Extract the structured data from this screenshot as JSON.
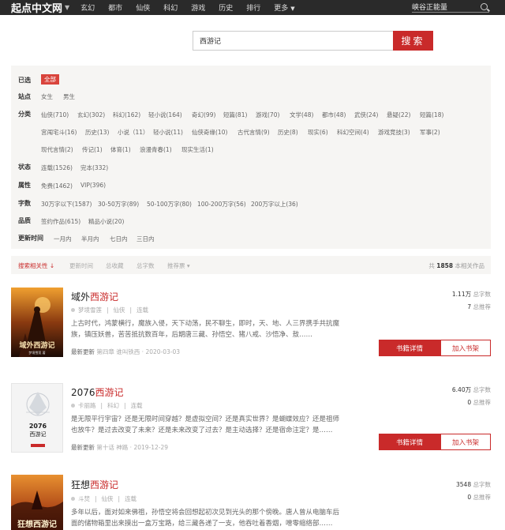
{
  "topnav": {
    "logo": "起点中文网",
    "links": [
      "玄幻",
      "都市",
      "仙侠",
      "科幻",
      "游戏",
      "历史",
      "排行",
      "更多"
    ],
    "search_text": "峡谷正能量"
  },
  "search": {
    "value": "西游记",
    "button_label": "搜索"
  },
  "filters": {
    "selected_label": "已选",
    "selected_value": "全部",
    "site_label": "站点",
    "site_options": [
      "女生",
      "男生"
    ],
    "category_label": "分类",
    "category_row1": [
      "仙侠(710)",
      "玄幻(302)",
      "科幻(162)",
      "轻小说(164)",
      "奇幻(99)",
      "短篇(81)",
      "游戏(70)",
      "文学(48)",
      "都市(48)",
      "武侠(24)",
      "悬疑(22)",
      "短篇(18)"
    ],
    "category_row2": [
      "宫闱宅斗(16)",
      "历史(13)",
      "小说（11）",
      "轻小说(11)",
      "仙侠奇缘(10)",
      "古代言情(9)",
      "历史(8)",
      "现实(6)",
      "科幻空间(4)",
      "游戏竞技(3)",
      "军事(2)"
    ],
    "category_row3": [
      "现代言情(2)",
      "传记(1)",
      "体育(1)",
      "浪漫青春(1)",
      "现实生活(1)"
    ],
    "status_label": "状态",
    "status_options": [
      "连载(1526)",
      "完本(332)"
    ],
    "attr_label": "属性",
    "attr_options": [
      "免费(1462)",
      "VIP(396)"
    ],
    "words_label": "字数",
    "words_options": [
      "30万字以下(1587)",
      "30-50万字(89)",
      "50-100万字(80)",
      "100-200万字(56)",
      "200万字以上(36)"
    ],
    "quality_label": "品质",
    "quality_options": [
      "签约作品(615)",
      "精品小说(20)"
    ],
    "update_label": "更新时间",
    "update_options": [
      "一月内",
      "半月内",
      "七日内",
      "三日内"
    ]
  },
  "sortbar": {
    "items": [
      "搜索相关性 ↓",
      "更新时间",
      "总收藏",
      "总字数",
      "推荐票 ▾"
    ],
    "count_prefix": "共",
    "count": "1858",
    "count_suffix": "本相关作品"
  },
  "books": [
    {
      "title_plain": "域外",
      "title_hl": "西游记",
      "author": "梦境雪莲",
      "genre": "仙侠",
      "status": "连载",
      "intro": "上古时代，鸿蒙横行，魔族入侵，天下动荡，民不聊生，即时，天、地、人三界携手共抗魔族，镇压妖兽，苦苦抵抗数百年，后期唐三藏、孙悟空、猪八戒、沙悟净、敖……",
      "update_label": "最新更新",
      "update_chapter": "第四章 谁叫铁西",
      "update_time": "2020-03-03",
      "words_num": "1.11万",
      "words_unit": "总字数",
      "rec_num": "7",
      "rec_unit": "总推荐",
      "detail_label": "书籍详情",
      "shelf_label": "加入书架",
      "cover_text": "域外西游记",
      "cover_author": "梦境雪莲 著"
    },
    {
      "title_plain": "2076",
      "title_hl": "西游记",
      "author": "卡丽路",
      "genre": "科幻",
      "status": "连载",
      "intro": "是无限平行宇宙？还是无限时间穿越？是虚拟空间？还是真实世界？是蝴蝶效应？还是祖师也放牛？是过去改变了未来？还是未来改变了过去？是主动选择？还是宿命注定？是……",
      "update_label": "最新更新",
      "update_chapter": "第十话 神路",
      "update_time": "2019-12-29",
      "words_num": "6.40万",
      "words_unit": "总字数",
      "rec_num": "0",
      "rec_unit": "总推荐",
      "detail_label": "书籍详情",
      "shelf_label": "加入书架",
      "cover_text": "2076\n西游记",
      "cover_author": ""
    },
    {
      "title_plain": "狂想",
      "title_hl": "西游记",
      "author": "斗焚",
      "genre": "仙侠",
      "status": "连载",
      "intro": "多年以后，面对如来佛祖，孙悟空将会回想起初次见到光头的那个傍晚。唐人曾从电脑车后面的储物箱里出来摸出一盒万宝路，给三藏各递了一支，他吞吐着香烟，噌零缩络部……",
      "update_label": "",
      "update_chapter": "",
      "update_time": "",
      "words_num": "3548",
      "words_unit": "总字数",
      "rec_num": "0",
      "rec_unit": "总推荐",
      "detail_label": "",
      "shelf_label": "",
      "cover_text": "狂想西游记",
      "cover_author": ""
    }
  ],
  "colors": {
    "accent": "#c92a2a",
    "nav_bg": "#2a2a2a",
    "panel_bg": "#f6f5f3"
  }
}
